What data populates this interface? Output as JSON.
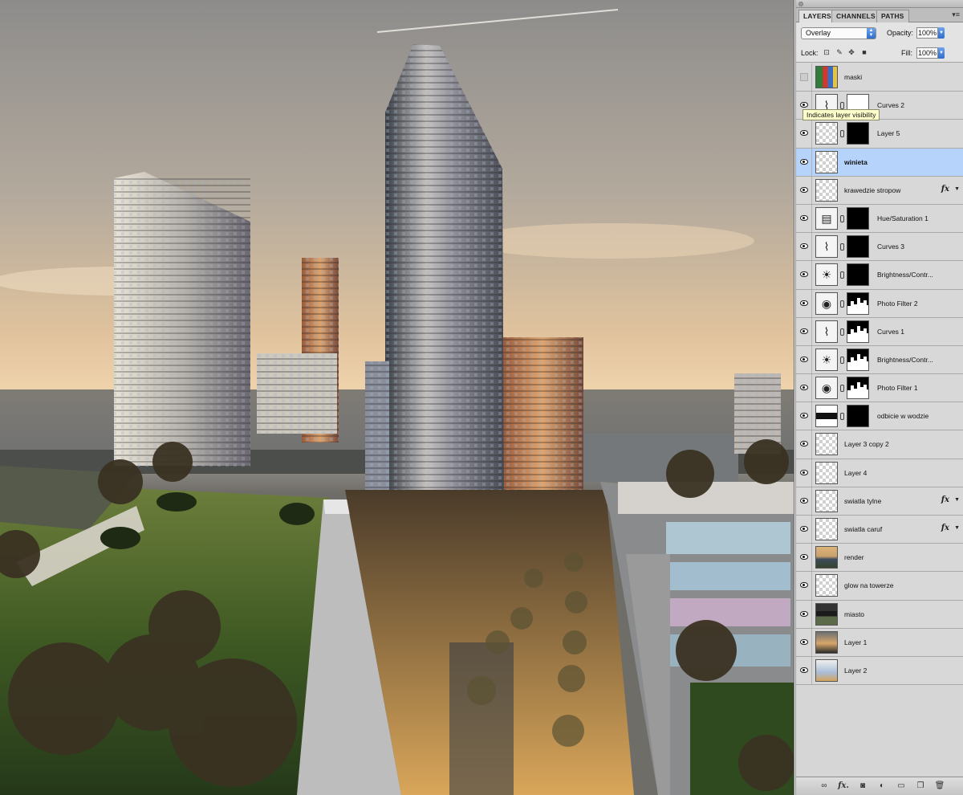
{
  "panel": {
    "tabs": [
      "LAYERS",
      "CHANNELS",
      "PATHS"
    ],
    "active_tab": "LAYERS",
    "blend_mode": "Overlay",
    "opacity_label": "Opacity:",
    "opacity_value": "100%",
    "lock_label": "Lock:",
    "fill_label": "Fill:",
    "fill_value": "100%"
  },
  "tooltip": "Indicates layer visibility",
  "layers": [
    {
      "name": "maski",
      "visible": false,
      "thumb": "img-mask",
      "mask": null,
      "fx": false,
      "selected": false
    },
    {
      "name": "Curves 2",
      "visible": true,
      "thumb": "curves",
      "mask": "white",
      "fx": false,
      "selected": false
    },
    {
      "name": "Layer 5",
      "visible": true,
      "thumb": "transparent",
      "mask": "black",
      "fx": false,
      "selected": false
    },
    {
      "name": "winieta",
      "visible": true,
      "thumb": "transparent",
      "mask": null,
      "fx": false,
      "selected": true
    },
    {
      "name": "krawedzie stropow",
      "visible": true,
      "thumb": "transparent",
      "mask": null,
      "fx": true,
      "selected": false
    },
    {
      "name": "Hue/Saturation 1",
      "visible": true,
      "thumb": "huesat",
      "mask": "black",
      "fx": false,
      "selected": false
    },
    {
      "name": "Curves 3",
      "visible": true,
      "thumb": "curves",
      "mask": "black",
      "fx": false,
      "selected": false
    },
    {
      "name": "Brightness/Contr...",
      "visible": true,
      "thumb": "brightness",
      "mask": "black",
      "fx": false,
      "selected": false
    },
    {
      "name": "Photo Filter 2",
      "visible": true,
      "thumb": "photofilter",
      "mask": "skyline",
      "fx": false,
      "selected": false
    },
    {
      "name": "Curves 1",
      "visible": true,
      "thumb": "curves",
      "mask": "skyline",
      "fx": false,
      "selected": false
    },
    {
      "name": "Brightness/Contr...",
      "visible": true,
      "thumb": "brightness",
      "mask": "skyline",
      "fx": false,
      "selected": false
    },
    {
      "name": "Photo Filter 1",
      "visible": true,
      "thumb": "photofilter",
      "mask": "skyline",
      "fx": false,
      "selected": false
    },
    {
      "name": "odbicie w wodzie",
      "visible": true,
      "thumb": "img-refl",
      "mask": "black",
      "fx": false,
      "selected": false
    },
    {
      "name": "Layer 3 copy 2",
      "visible": true,
      "thumb": "transparent",
      "mask": null,
      "fx": false,
      "selected": false
    },
    {
      "name": "Layer 4",
      "visible": true,
      "thumb": "transparent",
      "mask": null,
      "fx": false,
      "selected": false
    },
    {
      "name": "swiatla tylne",
      "visible": true,
      "thumb": "transparent",
      "mask": null,
      "fx": true,
      "selected": false
    },
    {
      "name": "swiatla caruf",
      "visible": true,
      "thumb": "transparent",
      "mask": null,
      "fx": true,
      "selected": false
    },
    {
      "name": "render",
      "visible": true,
      "thumb": "img-city",
      "mask": null,
      "fx": false,
      "selected": false
    },
    {
      "name": "glow na towerze",
      "visible": true,
      "thumb": "transparent",
      "mask": null,
      "fx": false,
      "selected": false
    },
    {
      "name": "miasto",
      "visible": true,
      "thumb": "img-dark",
      "mask": null,
      "fx": false,
      "selected": false
    },
    {
      "name": "Layer 1",
      "visible": true,
      "thumb": "img-sky1",
      "mask": null,
      "fx": false,
      "selected": false
    },
    {
      "name": "Layer 2",
      "visible": true,
      "thumb": "img-sky2",
      "mask": null,
      "fx": false,
      "selected": false
    }
  ],
  "bottom_icons": [
    "link-layers-icon",
    "layer-style-icon",
    "add-mask-icon",
    "adjustment-layer-icon",
    "new-group-icon",
    "new-layer-icon",
    "trash-icon"
  ],
  "colors": {
    "selected_row": "#b5d3fb",
    "panel_bg": "#d6d6d6",
    "tooltip_bg": "#ffffcc"
  }
}
